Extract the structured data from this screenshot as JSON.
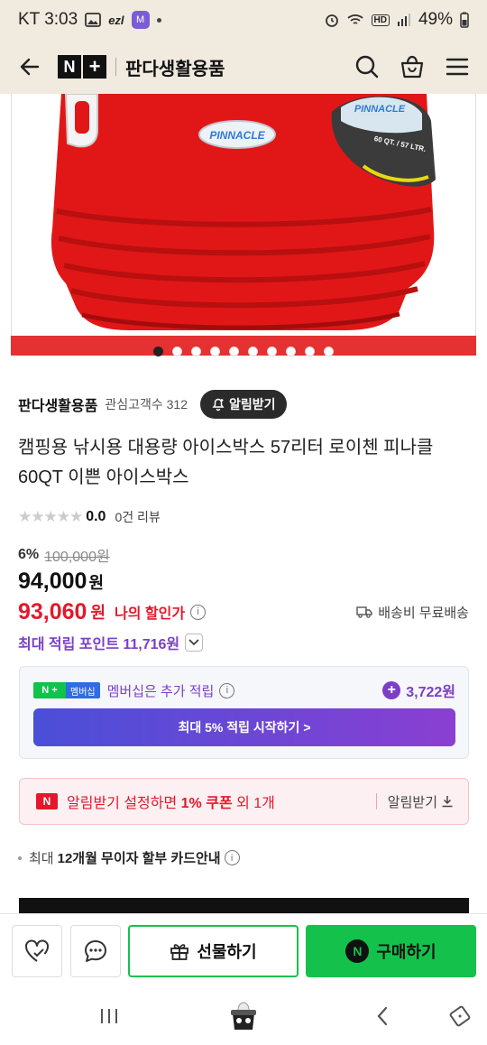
{
  "statusbar": {
    "carrier_time": "KT 3:03",
    "ezl": "ezl",
    "badge": "M",
    "battery": "49%"
  },
  "header": {
    "store_name": "판다생활용품"
  },
  "product_image": {
    "brand": "PINNACLE",
    "capacity_label": "60 QT. / 57 LTR.",
    "total_slides": 10,
    "active_slide": 1
  },
  "store": {
    "name": "판다생활용품",
    "fans": "관심고객수 312",
    "alarm_label": "알림받기"
  },
  "product": {
    "title": "캠핑용 낚시용 대용량 아이스박스 57리터 로이첸 피나클 60QT 이쁜 아이스박스"
  },
  "rating": {
    "stars": "★★★★★",
    "value": "0.0",
    "reviews": "0건 리뷰"
  },
  "price": {
    "discount_pct": "6%",
    "original": "100,000원",
    "sale": "94,000",
    "won": "원",
    "my_price": "93,060",
    "my_won": "원",
    "my_label": "나의 할인가",
    "shipping": "배송비 무료배송"
  },
  "points": {
    "label": "최대 적립 포인트 11,716원"
  },
  "membership": {
    "badge_np": "N +",
    "badge_label": "멤버십",
    "text": "멤버십은 추가 적립",
    "amount": "3,722원",
    "cta": "최대 5% 적립 시작하기 >"
  },
  "coupon": {
    "badge": "N",
    "text_pre": "알림받기 설정하면 ",
    "text_bold": "1% 쿠폰",
    "text_post": " 외 1개",
    "action": "알림받기"
  },
  "card": {
    "pre": "최대",
    "bold": "12개월 무이자 할부 카드안내"
  },
  "bottom": {
    "gift": "선물하기",
    "buy": "구매하기",
    "buy_badge": "N"
  }
}
